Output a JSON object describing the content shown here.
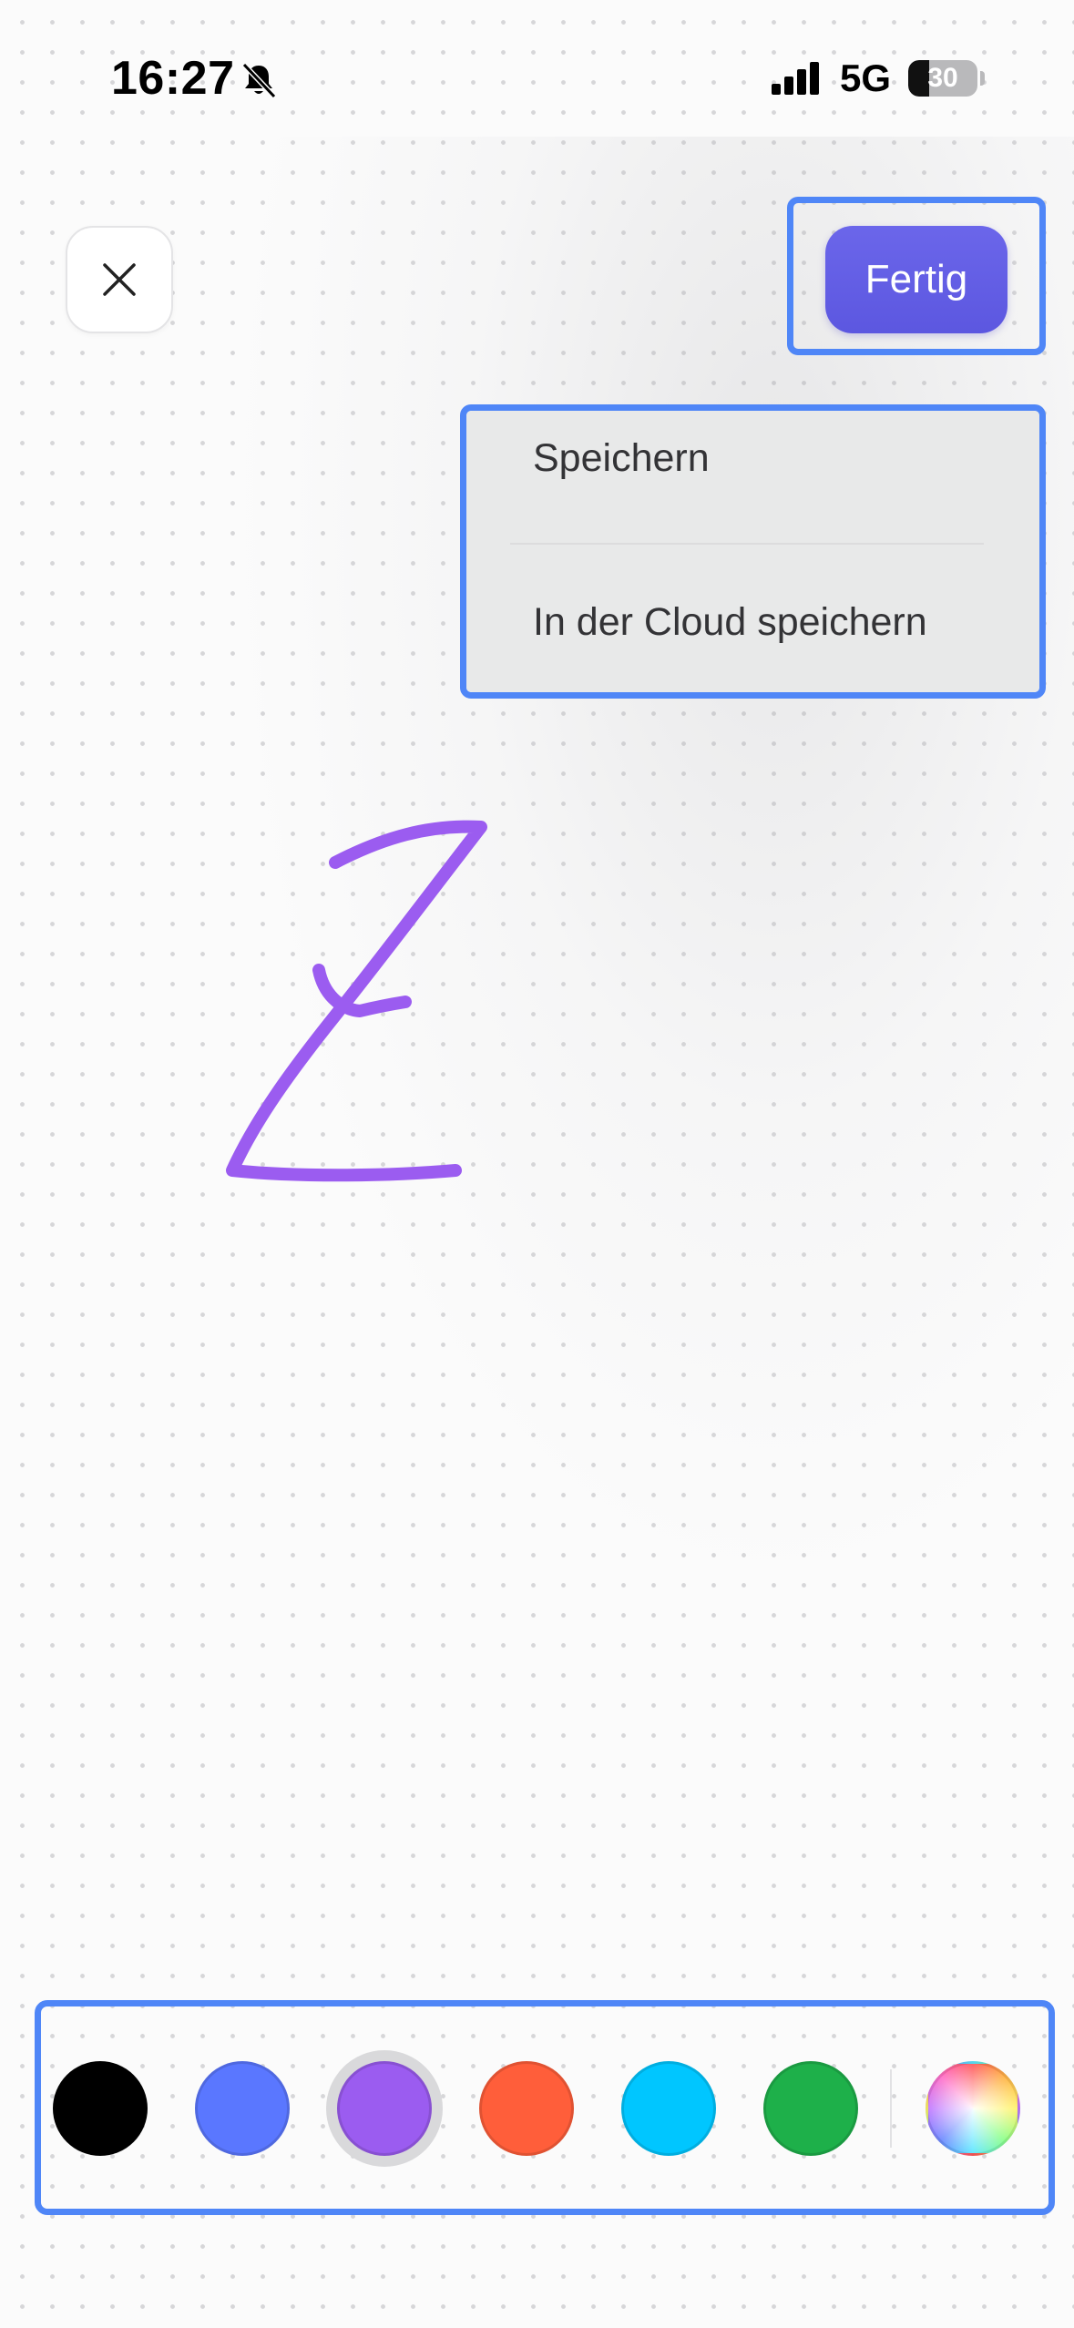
{
  "status_bar": {
    "time": "16:27",
    "network": "5G",
    "battery": "30",
    "battery_level": 0.3,
    "icons": [
      "bell-slash-icon",
      "cellular-signal-icon",
      "battery-icon"
    ]
  },
  "header": {
    "close_icon": "close-icon",
    "done_label": "Fertig"
  },
  "save_menu": {
    "items": [
      {
        "label": "Speichern"
      },
      {
        "label": "In der Cloud speichern"
      }
    ]
  },
  "canvas": {
    "stroke_color": "#9b5cf0",
    "background": "dot-grid"
  },
  "palette": {
    "selected_index": 2,
    "colors": [
      "#000000",
      "#5a77ff",
      "#9b5cf0",
      "#ff5e3a",
      "#00c6ff",
      "#1eb04a"
    ],
    "custom_icon": "color-wheel-icon"
  },
  "highlight_color": "#4f86f7",
  "accent_color": "#5f5be3"
}
